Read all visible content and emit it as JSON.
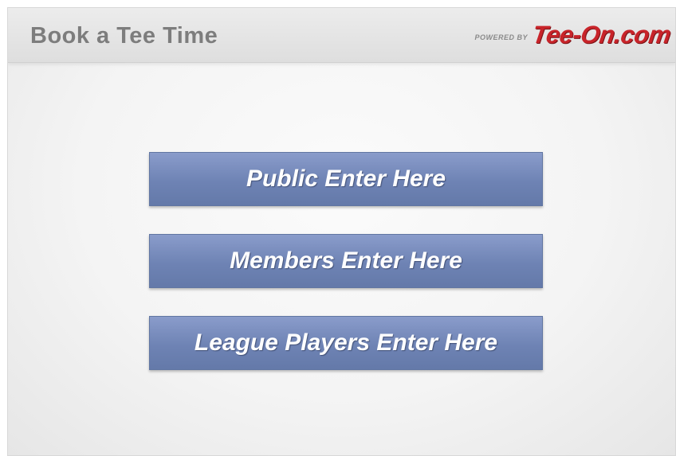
{
  "header": {
    "title": "Book a Tee Time",
    "powered_by": "POWERED BY",
    "brand": "Tee-On.com"
  },
  "buttons": {
    "public": "Public Enter Here",
    "members": "Members Enter Here",
    "league": "League Players Enter Here"
  },
  "colors": {
    "button": "#7489b8",
    "brand": "#c8242a",
    "title": "#7d7d7d"
  }
}
